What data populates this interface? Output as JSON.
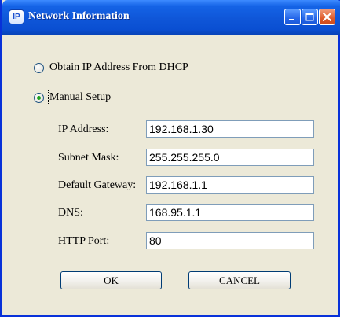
{
  "window": {
    "title": "Network Information",
    "icon_text": "IP"
  },
  "title_buttons": [
    "minimize",
    "maximize",
    "close"
  ],
  "options": {
    "dhcp_label": "Obtain IP Address From DHCP",
    "dhcp_selected": false,
    "manual_label": "Manual Setup",
    "manual_selected": true
  },
  "fields": {
    "ip_label": "IP Address:",
    "ip_value": "192.168.1.30",
    "subnet_label": "Subnet Mask:",
    "subnet_value": "255.255.255.0",
    "gateway_label": "Default Gateway:",
    "gateway_value": "192.168.1.1",
    "dns_label": "DNS:",
    "dns_value": "168.95.1.1",
    "port_label": "HTTP Port:",
    "port_value": "80"
  },
  "buttons": {
    "ok_label": "OK",
    "cancel_label": "CANCEL"
  },
  "colors": {
    "titlebar": "#0f56d8",
    "window_bg": "#ece9d8",
    "close_button": "#de5a2a",
    "radio_dot": "#21a121"
  }
}
